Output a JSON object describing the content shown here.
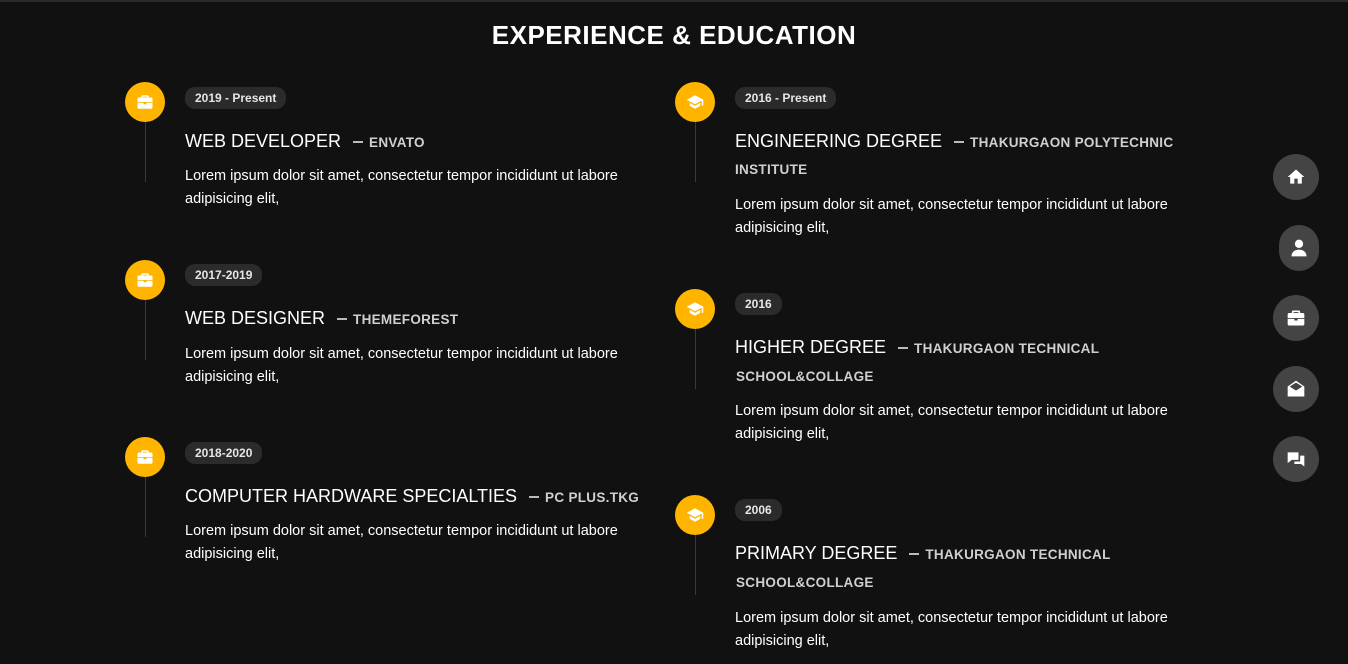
{
  "section": {
    "title": "EXPERIENCE & EDUCATION"
  },
  "experience": [
    {
      "period": "2019 - Present",
      "role": "WEB DEVELOPER",
      "place": "ENVATO",
      "place_cont": "",
      "desc_line1": "Lorem ipsum dolor sit amet, consectetur tempor incididunt ut labore",
      "desc_line2": "adipisicing elit,",
      "icon": "briefcase-icon"
    },
    {
      "period": "2017-2019",
      "role": "WEB DESIGNER",
      "place": "THEMEFOREST",
      "place_cont": "",
      "desc_line1": "Lorem ipsum dolor sit amet, consectetur tempor incididunt ut labore",
      "desc_line2": "adipisicing elit,",
      "icon": "briefcase-icon"
    },
    {
      "period": "2018-2020",
      "role": "COMPUTER HARDWARE SPECIALTIES",
      "place": "PC PLUS.TKG",
      "place_cont": "",
      "desc_line1": "Lorem ipsum dolor sit amet, consectetur tempor incididunt ut labore",
      "desc_line2": "adipisicing elit,",
      "icon": "briefcase-icon"
    }
  ],
  "education": [
    {
      "period": "2016 - Present",
      "role": "ENGINEERING DEGREE",
      "place": "THAKURGAON POLYTECHNIC",
      "place_cont": "INSTITUTE",
      "desc_line1": "Lorem ipsum dolor sit amet, consectetur tempor incididunt ut labore",
      "desc_line2": "adipisicing elit,",
      "icon": "graduation-cap-icon"
    },
    {
      "period": "2016",
      "role": "HIGHER DEGREE",
      "place": "THAKURGAON TECHNICAL",
      "place_cont": "SCHOOL&COLLAGE",
      "desc_line1": "Lorem ipsum dolor sit amet, consectetur tempor incididunt ut labore",
      "desc_line2": "adipisicing elit,",
      "icon": "graduation-cap-icon"
    },
    {
      "period": "2006",
      "role": "PRIMARY DEGREE",
      "place": "THAKURGAON TECHNICAL",
      "place_cont": "SCHOOL&COLLAGE",
      "desc_line1": "Lorem ipsum dolor sit amet, consectetur tempor incididunt ut labore",
      "desc_line2": "adipisicing elit,",
      "icon": "graduation-cap-icon"
    }
  ],
  "side_nav": [
    {
      "icon": "home-icon"
    },
    {
      "icon": "user-icon"
    },
    {
      "icon": "briefcase-icon"
    },
    {
      "icon": "envelope-open-icon"
    },
    {
      "icon": "comments-icon"
    }
  ],
  "colors": {
    "accent": "#ffb400",
    "background": "#111111",
    "badge_bg": "#2b2b2b",
    "nav_btn_bg": "#444444"
  }
}
